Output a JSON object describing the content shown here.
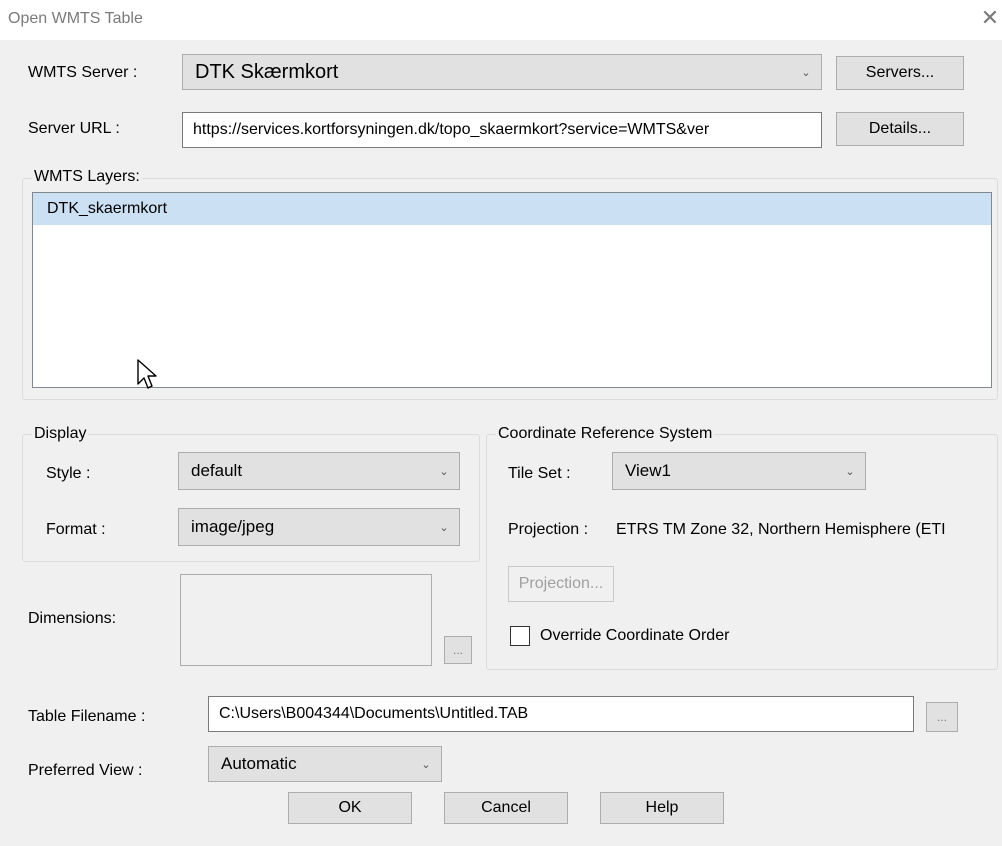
{
  "window": {
    "title": "Open WMTS Table"
  },
  "wmts_server": {
    "label": "WMTS Server :",
    "value": "DTK Skærmkort",
    "servers_button": "Servers..."
  },
  "server_url": {
    "label": "Server URL :",
    "value": "https://services.kortforsyningen.dk/topo_skaermkort?service=WMTS&ver",
    "details_button": "Details..."
  },
  "layers": {
    "legend": "WMTS Layers:",
    "items": [
      "DTK_skaermkort"
    ]
  },
  "display": {
    "legend": "Display",
    "style_label": "Style :",
    "style_value": "default",
    "format_label": "Format :",
    "format_value": "image/jpeg"
  },
  "dimensions": {
    "label": "Dimensions:",
    "browse_button": "..."
  },
  "crs": {
    "legend": "Coordinate Reference System",
    "tileset_label": "Tile Set :",
    "tileset_value": "View1",
    "projection_label": "Projection :",
    "projection_value": "ETRS TM Zone 32, Northern Hemisphere (ETI",
    "projection_button": "Projection...",
    "override_label": "Override Coordinate Order",
    "override_checked": false
  },
  "table_filename": {
    "label": "Table Filename :",
    "value": "C:\\Users\\B004344\\Documents\\Untitled.TAB",
    "browse_button": "..."
  },
  "preferred_view": {
    "label": "Preferred View :",
    "value": "Automatic"
  },
  "buttons": {
    "ok": "OK",
    "cancel": "Cancel",
    "help": "Help"
  },
  "colors": {
    "selection": "#cce0f4",
    "button_face": "#e1e1e1",
    "dialog_bg": "#f0f0f0"
  }
}
